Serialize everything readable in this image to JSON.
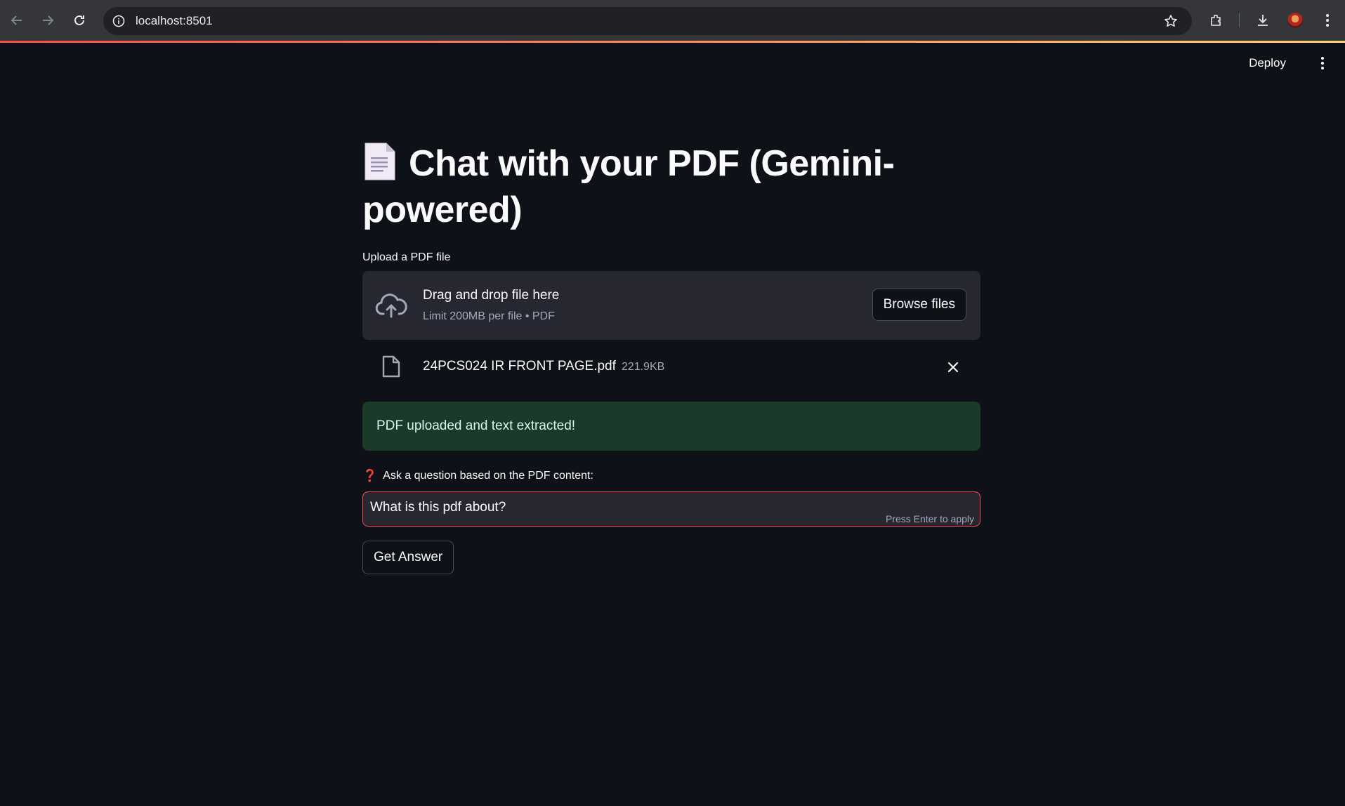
{
  "browser": {
    "url": "localhost:8501",
    "icons": [
      "back-icon",
      "forward-icon",
      "reload-icon",
      "site-info-icon",
      "bookmark-star-icon",
      "extensions-icon",
      "download-icon",
      "profile-avatar",
      "chrome-menu-icon"
    ]
  },
  "header": {
    "deploy_label": "Deploy"
  },
  "main": {
    "title": "Chat with your PDF (Gemini-powered)",
    "title_icon": "page-facing-up-icon",
    "upload_label": "Upload a PDF file",
    "dropzone": {
      "title": "Drag and drop file here",
      "subtitle": "Limit 200MB per file • PDF",
      "browse_label": "Browse files"
    },
    "uploaded_file": {
      "name": "24PCS024 IR FRONT PAGE.pdf",
      "size": "221.9KB"
    },
    "success_message": "PDF uploaded and text extracted!",
    "question": {
      "icon": "❓",
      "label": "Ask a question based on the PDF content:",
      "value": "What is this pdf about?",
      "hint": "Press Enter to apply"
    },
    "get_answer_label": "Get Answer"
  },
  "colors": {
    "background": "#0e1117",
    "panel": "#262730",
    "accent": "#ff4b4b",
    "success_bg": "#1a3a2a"
  }
}
